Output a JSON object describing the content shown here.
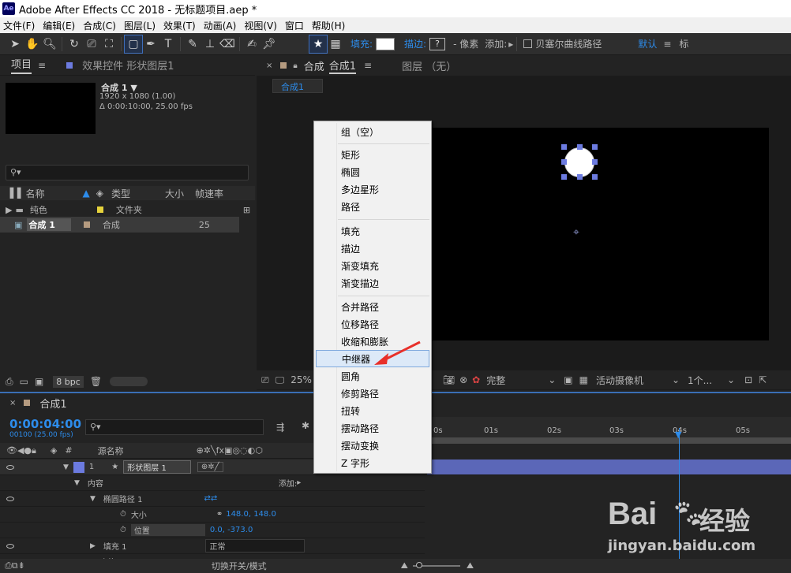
{
  "window": {
    "title": "Adobe After Effects CC 2018 - 无标题项目.aep *",
    "app_icon": "Ae"
  },
  "menubar": [
    "文件(F)",
    "编辑(E)",
    "合成(C)",
    "图层(L)",
    "效果(T)",
    "动画(A)",
    "视图(V)",
    "窗口",
    "帮助(H)"
  ],
  "toolbar": {
    "fill_label": "填充:",
    "stroke_label": "描边:",
    "stroke_value": "?",
    "px_label": "- 像素",
    "add_label": "添加:",
    "bezier_label": "贝塞尔曲线路径",
    "workspace": "默认",
    "workspace2": "标"
  },
  "project_panel": {
    "tab": "项目",
    "effects_tab": "效果控件 形状图层1",
    "comp_name": "合成 1 ▼",
    "comp_res": "1920 x 1080 (1.00)",
    "comp_dur": "Δ 0:00:10:00, 25.00 fps",
    "search_placeholder": "",
    "col_name": "名称",
    "col_type": "类型",
    "col_size": "大小",
    "col_fps": "帧速率",
    "rows": [
      {
        "name": "纯色",
        "type": "文件夹",
        "fps": "",
        "color": "#e6d33c"
      },
      {
        "name": "合成 1",
        "type": "合成",
        "fps": "25",
        "color": "#b59b80"
      }
    ],
    "bpc": "8 bpc"
  },
  "comp_panel": {
    "tab": "合成",
    "tab_name": "合成1",
    "layer_tab": "图层 （无）",
    "sub_tab": "合成1",
    "zoom": "25%",
    "quality": "完整",
    "camera": "活动摄像机",
    "views": "1个..."
  },
  "context_menu": {
    "groups": [
      [
        "组（空）"
      ],
      [
        "矩形",
        "椭圆",
        "多边星形",
        "路径"
      ],
      [
        "填充",
        "描边",
        "渐变填充",
        "渐变描边"
      ],
      [
        "合并路径",
        "位移路径",
        "收缩和膨胀",
        "中继器",
        "圆角",
        "修剪路径",
        "扭转",
        "摆动路径",
        "摆动变换",
        "Z 字形"
      ]
    ],
    "highlighted": "中继器"
  },
  "timeline": {
    "tab": "合成1",
    "timecode": "0:00:04:00",
    "frame_info": "00100 (25.00 fps)",
    "col_source": "源名称",
    "ruler": [
      "0s",
      "01s",
      "02s",
      "03s",
      "04s",
      "05s"
    ],
    "layers": [
      {
        "index": "1",
        "name": "形状图层 1"
      },
      {
        "name": "内容",
        "add": "添加:"
      },
      {
        "name": "椭圆路径 1"
      },
      {
        "name": "大小",
        "value": "148.0, 148.0"
      },
      {
        "name": "位置",
        "value": "0.0, -373.0"
      },
      {
        "name": "填充 1",
        "mode": "正常"
      },
      {
        "name": "变换"
      }
    ],
    "switch_label": "切换开关/模式"
  },
  "watermark": {
    "brand": "Bai",
    "brand2": "经验",
    "url": "jingyan.baidu.com"
  }
}
